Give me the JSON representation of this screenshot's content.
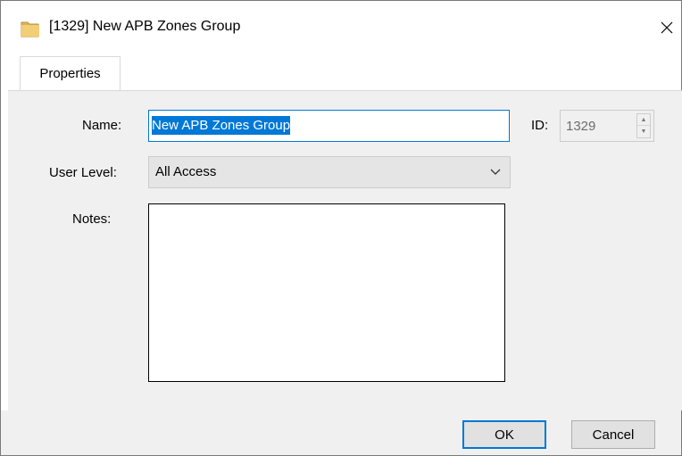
{
  "window": {
    "title": "[1329] New APB Zones Group",
    "icon": "folder-icon",
    "close_icon": "close-icon"
  },
  "tabs": [
    {
      "label": "Properties",
      "active": true
    }
  ],
  "form": {
    "name_label": "Name:",
    "name_value": "New APB Zones Group",
    "id_label": "ID:",
    "id_value": "1329",
    "user_level_label": "User Level:",
    "user_level_value": "All Access",
    "notes_label": "Notes:",
    "notes_value": ""
  },
  "buttons": {
    "ok_label": "OK",
    "cancel_label": "Cancel"
  },
  "colors": {
    "accent": "#0078d7",
    "panel_bg": "#f0f0f0",
    "folder_yellow": "#e8c66a"
  }
}
